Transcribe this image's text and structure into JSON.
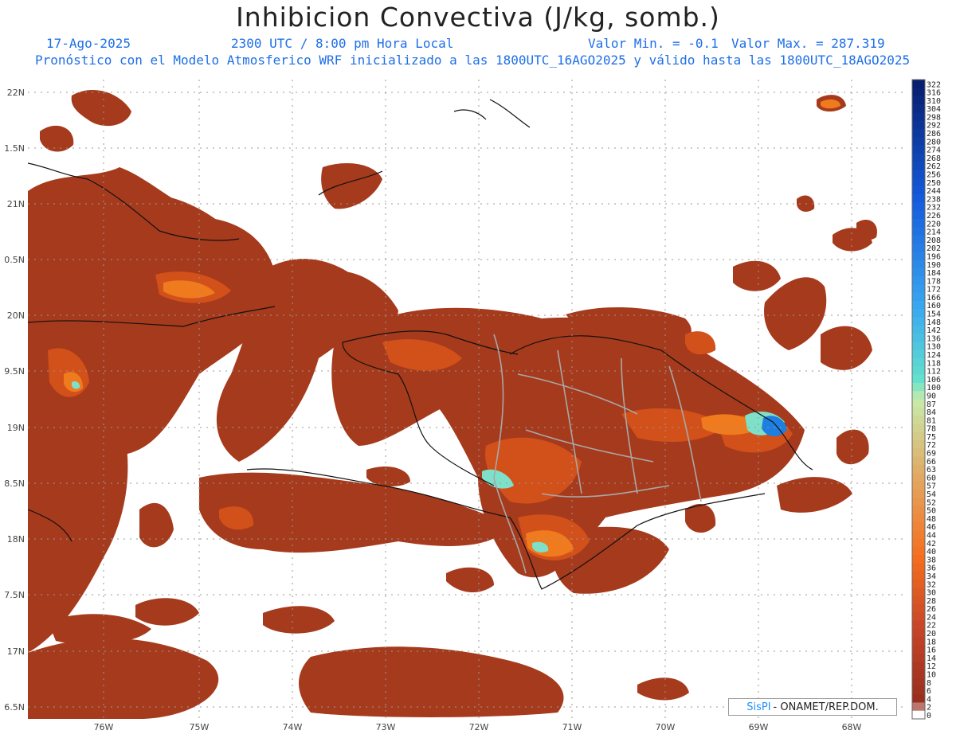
{
  "header": {
    "title": "Inhibicion Convectiva (J/kg, somb.)",
    "date": "17-Ago-2025",
    "time": "2300 UTC / 8:00 pm Hora Local",
    "min_label": "Valor Min. = -0.1",
    "max_label": "Valor Max. = 287.319",
    "model_line": "Pronóstico con el Modelo Atmosferico WRF inicializado a las 1800UTC_16AGO2025 y válido hasta las  1800UTC_18AGO2025"
  },
  "map": {
    "lat_labels": [
      "22N",
      "1.5N",
      "21N",
      "0.5N",
      "20N",
      "9.5N",
      "19N",
      "8.5N",
      "18N",
      "7.5N",
      "17N",
      "6.5N"
    ],
    "lon_labels": [
      "76W",
      "75W",
      "74W",
      "73W",
      "72W",
      "71W",
      "70W",
      "69W",
      "68W"
    ],
    "field_colors": {
      "base": "#a63a1c",
      "mid": "#d2501a",
      "high": "#f07a1e",
      "peak": "#7ee0c8",
      "max": "#1e7fe0"
    }
  },
  "colorbar": {
    "labels": [
      "322",
      "316",
      "310",
      "304",
      "298",
      "292",
      "286",
      "280",
      "274",
      "268",
      "262",
      "256",
      "250",
      "244",
      "238",
      "232",
      "226",
      "220",
      "214",
      "208",
      "202",
      "196",
      "190",
      "184",
      "178",
      "172",
      "166",
      "160",
      "154",
      "148",
      "142",
      "136",
      "130",
      "124",
      "118",
      "112",
      "106",
      "100",
      "90",
      "87",
      "84",
      "81",
      "78",
      "75",
      "72",
      "69",
      "66",
      "63",
      "60",
      "57",
      "54",
      "52",
      "50",
      "48",
      "46",
      "44",
      "42",
      "40",
      "38",
      "36",
      "34",
      "32",
      "30",
      "28",
      "26",
      "24",
      "22",
      "20",
      "18",
      "16",
      "14",
      "12",
      "10",
      "8",
      "6",
      "4",
      "2",
      "0"
    ]
  },
  "credit": {
    "brand": "SisPI",
    "text": "- ONAMET/REP.DOM."
  }
}
